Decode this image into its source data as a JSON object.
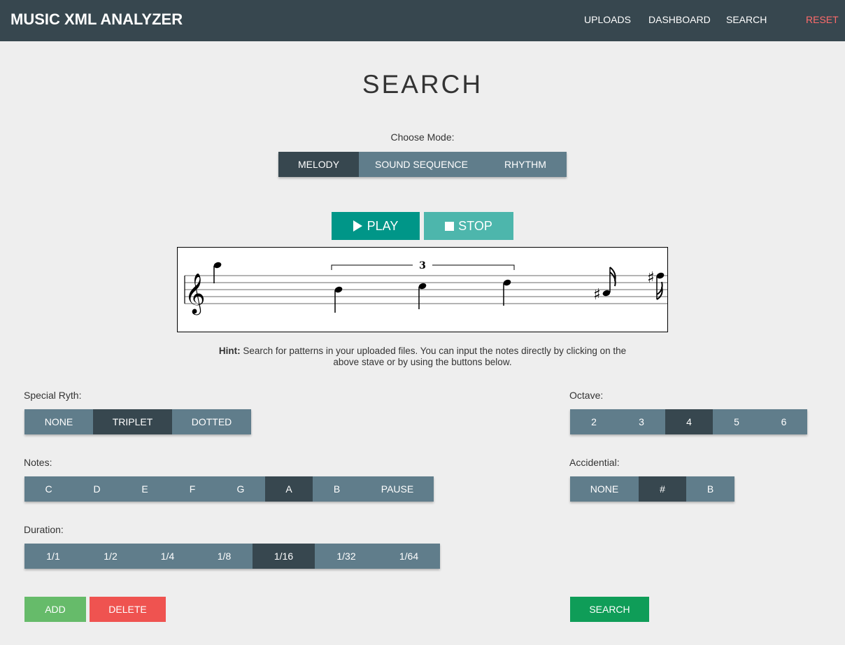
{
  "app": {
    "brand": "MUSIC XML ANALYZER",
    "nav": {
      "uploads": "UPLOADS",
      "dashboard": "DASHBOARD",
      "search": "SEARCH",
      "reset": "RESET"
    }
  },
  "page": {
    "title": "SEARCH"
  },
  "mode": {
    "label": "Choose Mode:",
    "options": [
      "MELODY",
      "SOUND SEQUENCE",
      "RHYTHM"
    ],
    "selected": "MELODY"
  },
  "player": {
    "play_label": "PLAY",
    "stop_label": "STOP"
  },
  "stave": {
    "tuplet_label": "3"
  },
  "hint": {
    "bold": "Hint:",
    "text": " Search for patterns in your uploaded files. You can input the notes directly by clicking on the above stave or by using the buttons below."
  },
  "special_rhythm": {
    "label": "Special Ryth:",
    "options": [
      "NONE",
      "TRIPLET",
      "DOTTED"
    ],
    "selected": "TRIPLET"
  },
  "notes": {
    "label": "Notes:",
    "options": [
      "C",
      "D",
      "E",
      "F",
      "G",
      "A",
      "B",
      "PAUSE"
    ],
    "selected": "A"
  },
  "duration": {
    "label": "Duration:",
    "options": [
      "1/1",
      "1/2",
      "1/4",
      "1/8",
      "1/16",
      "1/32",
      "1/64"
    ],
    "selected": "1/16"
  },
  "octave": {
    "label": "Octave:",
    "options": [
      "2",
      "3",
      "4",
      "5",
      "6"
    ],
    "selected": "4"
  },
  "accidential": {
    "label": "Accidential:",
    "options": [
      "NONE",
      "#",
      "B"
    ],
    "selected": "#"
  },
  "actions": {
    "add": "ADD",
    "delete": "DELETE",
    "search": "SEARCH"
  },
  "colors": {
    "navbar": "#37474f",
    "segment": "#607d8b",
    "segment_active": "#37474f",
    "play": "#009688",
    "stop": "#4db6ac",
    "add": "#66bb6a",
    "delete": "#ef5350",
    "search": "#0f9d58",
    "reset": "#ff6b6b"
  }
}
